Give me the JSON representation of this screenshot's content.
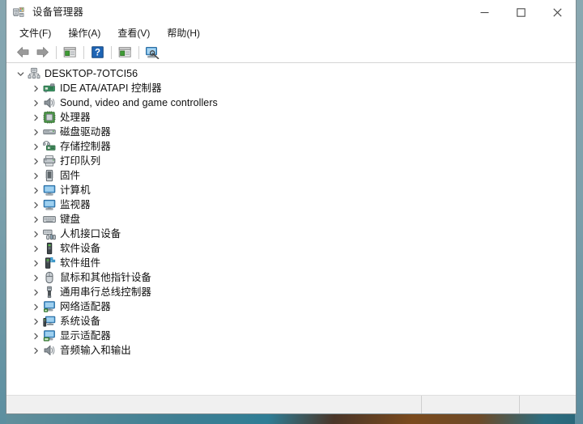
{
  "window": {
    "title": "设备管理器",
    "title_icon": "device-manager-icon",
    "controls": {
      "minimize": "minimize-icon",
      "maximize": "maximize-icon",
      "close": "close-icon"
    }
  },
  "menubar": {
    "items": [
      {
        "label": "文件(F)",
        "name": "menu-file"
      },
      {
        "label": "操作(A)",
        "name": "menu-action"
      },
      {
        "label": "查看(V)",
        "name": "menu-view"
      },
      {
        "label": "帮助(H)",
        "name": "menu-help"
      }
    ]
  },
  "toolbar": {
    "buttons": [
      {
        "icon": "back-arrow-icon",
        "name": "toolbar-back"
      },
      {
        "icon": "forward-arrow-icon",
        "name": "toolbar-forward"
      },
      {
        "icon": "separator",
        "name": "toolbar-separator-1"
      },
      {
        "icon": "properties-window-icon",
        "name": "toolbar-properties"
      },
      {
        "icon": "separator",
        "name": "toolbar-separator-2"
      },
      {
        "icon": "help-question-icon",
        "name": "toolbar-help"
      },
      {
        "icon": "separator",
        "name": "toolbar-separator-3"
      },
      {
        "icon": "show-hidden-window-icon",
        "name": "toolbar-show-hidden"
      },
      {
        "icon": "separator",
        "name": "toolbar-separator-4"
      },
      {
        "icon": "scan-hardware-monitor-icon",
        "name": "toolbar-scan-hardware"
      }
    ]
  },
  "tree": {
    "root": {
      "label": "DESKTOP-7OTCI56",
      "icon": "computer-root-icon",
      "expanded": true,
      "chevron": "chevron-down-icon"
    },
    "nodes": [
      {
        "label": "IDE ATA/ATAPI 控制器",
        "icon": "ide-controller-icon",
        "chevron": "chevron-right-icon"
      },
      {
        "label": "Sound, video and game controllers",
        "icon": "sound-video-game-icon",
        "chevron": "chevron-right-icon"
      },
      {
        "label": "处理器",
        "icon": "processor-icon",
        "chevron": "chevron-right-icon"
      },
      {
        "label": "磁盘驱动器",
        "icon": "disk-drive-icon",
        "chevron": "chevron-right-icon"
      },
      {
        "label": "存储控制器",
        "icon": "storage-controller-icon",
        "chevron": "chevron-right-icon"
      },
      {
        "label": "打印队列",
        "icon": "print-queue-icon",
        "chevron": "chevron-right-icon"
      },
      {
        "label": "固件",
        "icon": "firmware-icon",
        "chevron": "chevron-right-icon"
      },
      {
        "label": "计算机",
        "icon": "computer-icon",
        "chevron": "chevron-right-icon"
      },
      {
        "label": "监视器",
        "icon": "monitor-icon",
        "chevron": "chevron-right-icon"
      },
      {
        "label": "键盘",
        "icon": "keyboard-icon",
        "chevron": "chevron-right-icon"
      },
      {
        "label": "人机接口设备",
        "icon": "hid-device-icon",
        "chevron": "chevron-right-icon"
      },
      {
        "label": "软件设备",
        "icon": "software-device-icon",
        "chevron": "chevron-right-icon"
      },
      {
        "label": "软件组件",
        "icon": "software-component-icon",
        "chevron": "chevron-right-icon"
      },
      {
        "label": "鼠标和其他指针设备",
        "icon": "mouse-icon",
        "chevron": "chevron-right-icon"
      },
      {
        "label": "通用串行总线控制器",
        "icon": "usb-controller-icon",
        "chevron": "chevron-right-icon"
      },
      {
        "label": "网络适配器",
        "icon": "network-adapter-icon",
        "chevron": "chevron-right-icon"
      },
      {
        "label": "系统设备",
        "icon": "system-device-icon",
        "chevron": "chevron-right-icon"
      },
      {
        "label": "显示适配器",
        "icon": "display-adapter-icon",
        "chevron": "chevron-right-icon"
      },
      {
        "label": "音频输入和输出",
        "icon": "audio-input-output-icon",
        "chevron": "chevron-right-icon"
      }
    ]
  },
  "statusbar": {
    "main_text": "",
    "section2_text": "",
    "section3_text": ""
  },
  "colors": {
    "window_bg": "#ffffff",
    "titlebar_bg": "#ffffff",
    "statusbar_bg": "#f0f0f0",
    "window_border": "#7a8a8f",
    "text": "#101010",
    "toolbar_blue": "#1d64b5",
    "icon_green": "#3f9c35",
    "icon_blue": "#3b93d9",
    "desktop_teal": "#3f7f93",
    "desktop_brown": "#7a4a1d"
  }
}
